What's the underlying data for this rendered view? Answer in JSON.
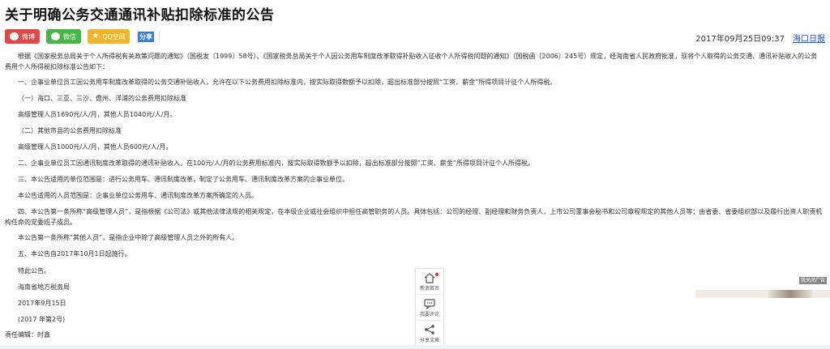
{
  "article": {
    "title": "关于明确公务交通通讯补贴扣除标准的公告",
    "date": "2017年09月25日09:37",
    "source": "海口日报"
  },
  "share": {
    "weibo": "微博",
    "wechat": "微信",
    "qq": "QQ空间",
    "more": "分享"
  },
  "paragraphs": [
    "根据《国家税务总局关于个人所得税有关政策问题的通知》（国税发〔1999〕58号）、《国家税务总局关于个人因公务用车制度改革取得补贴收入征收个人所得税问题的通知》（国税函〔2006〕245号）规定，经海南省人民政府批准，现将个人取得的公务交通、通讯补贴收入的公务费用个人所得税扣除标准公告如下：",
    "一、企事业单位员工因公务用车制度改革取得的公务交通补贴收入，允许在以下公务费用扣除标准内，按实际取得数额予以扣除，超出标准部分按照“工资、薪金”所得项目计征个人所得税。",
    "（一）海口、三亚、三沙、儋州、洋浦的公务费用扣除标准",
    "高级管理人员1690元/人/月，其他人员1040元/人/月。",
    "（二）其他市县的公务费用扣除标准",
    "高级管理人员1000元/人/月，其他人员600元/人/月。",
    "二、企事业单位员工因通讯制度改革取得的通讯补贴收入，在100元/人/月的公务费用标准内，按实际取得数额予以扣除，超出标准部分按照“工资、薪金”所得项目计征个人所得税。",
    "三、本公告适用的单位范围是：进行公务用车、通讯制度改革，制定了公务用车、通讯制度改革方案的企事业单位。",
    "本公告适用的人员范围是：企事业单位公务用车、通讯制度改革方案所确定的人员。",
    "四、本公告第一条所称“高级管理人员”，是指根据《公司法》或其他法律法规的相关规定，在本级企业或社会组织中担任高管职务的人员。具体包括：公司的经理、副经理和财务负责人，上市公司董事会秘书和公司章程规定的其他人员等；由省委、省委组织部以及履行出资人职责机构任命的党委班子成员。",
    "本公告第一条所称“其他人员”，是指企业中除了高级管理人员之外的所有人。",
    "五、本公告自2017年10月1日起施行。",
    "特此公告。",
    "海南省地方税务局",
    "2017年9月15日",
    "(2017 年第2号)"
  ],
  "editor": "责任编辑：时鑫",
  "floatbar": {
    "home": "新浪首页",
    "comment": "我要评论",
    "share": "分享文章"
  },
  "ad": {
    "label": "我关闭广告"
  },
  "colors": {
    "weibo": "#e04848",
    "wechat": "#48b548",
    "qq": "#f2b429",
    "link": "#1a56c7"
  }
}
